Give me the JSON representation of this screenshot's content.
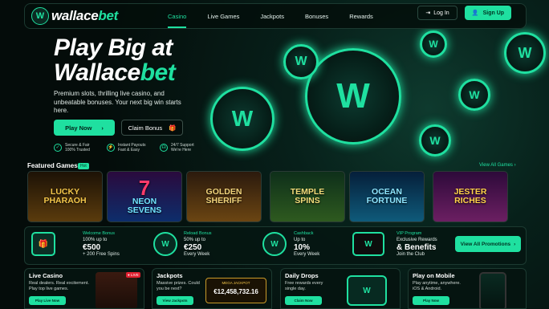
{
  "logo": {
    "prefix": "wallace",
    "suffix": "bet"
  },
  "nav": {
    "items": [
      {
        "label": "Casino"
      },
      {
        "label": "Live Games"
      },
      {
        "label": "Jackpots"
      },
      {
        "label": "Bonuses"
      },
      {
        "label": "Rewards"
      }
    ],
    "login": "Log In",
    "signup": "Sign Up"
  },
  "hero": {
    "line1": "Play Big at",
    "line2a": "Wallace",
    "line2b": "bet",
    "subtitle": "Premium slots, thrilling live casino, and unbeatable bonuses. Your next big win starts here.",
    "play": "Play Now",
    "claim": "Claim Bonus",
    "features": [
      {
        "title": "Secure & Fair",
        "sub": "100% Trusted"
      },
      {
        "title": "Instant Payouts",
        "sub": "Fast & Easy"
      },
      {
        "title": "24/7 Support",
        "sub": "We're Here"
      }
    ]
  },
  "games": {
    "title": "Featured Games",
    "badge": "Hot",
    "view_all": "View All Games",
    "items": [
      {
        "l1": "LUCKY",
        "l2": "PHARAOH"
      },
      {
        "l1": "NEON",
        "l2": "SEVENS"
      },
      {
        "l1": "GOLDEN",
        "l2": "SHERIFF"
      },
      {
        "l1": "TEMPLE",
        "l2": "SPINS"
      },
      {
        "l1": "OCEAN",
        "l2": "FORTUNE"
      },
      {
        "l1": "JESTER",
        "l2": "RICHES"
      }
    ]
  },
  "promos": [
    {
      "title": "Welcome Bonus",
      "l1": "100% up to",
      "big": "€500",
      "l3": "+ 200 Free Spins"
    },
    {
      "title": "Reload Bonus",
      "l1": "50% up to",
      "big": "€250",
      "l3": "Every Week"
    },
    {
      "title": "Cashback",
      "l1": "Up to",
      "big": "10%",
      "l3": "Every Week"
    },
    {
      "title": "VIP Program",
      "l1": "Exclusive Rewards",
      "big": "& Benefits",
      "l3": "Join the Club"
    }
  ],
  "promo_button": "View All Promotions",
  "cards": [
    {
      "title": "Live Casino",
      "desc": "Real dealers. Real excitement. Play top live games.",
      "btn": "Play Live Now"
    },
    {
      "title": "Jackpots",
      "desc": "Massive prizes. Could you be next?",
      "btn": "View Jackpots",
      "jackpot_label": "MEGA JACKPOT",
      "jackpot_value": "€12,458,732.16"
    },
    {
      "title": "Daily Drops",
      "desc": "Free rewards every single day.",
      "btn": "Claim Now"
    },
    {
      "title": "Play on Mobile",
      "desc": "Play anytime, anywhere. iOS & Android.",
      "btn": "Play Now"
    }
  ],
  "colors": {
    "accent": "#1fe0a0",
    "bg": "#05100d"
  }
}
